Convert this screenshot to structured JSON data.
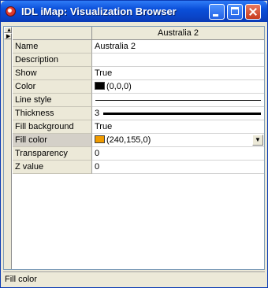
{
  "window": {
    "title": "IDL iMap: Visualization Browser",
    "title_bar_color": "#0a4fd9"
  },
  "grid": {
    "column_header": "Australia 2",
    "rows": [
      {
        "label": "Name",
        "value": "Australia 2"
      },
      {
        "label": "Description",
        "value": ""
      },
      {
        "label": "Show",
        "value": "True"
      },
      {
        "label": "Color",
        "value": "(0,0,0)",
        "swatch": "#000000"
      },
      {
        "label": "Line style",
        "value": ""
      },
      {
        "label": "Thickness",
        "value": "3"
      },
      {
        "label": "Fill background",
        "value": "True"
      },
      {
        "label": "Fill color",
        "value": "(240,155,0)",
        "swatch": "#f09b00"
      },
      {
        "label": "Transparency",
        "value": "0"
      },
      {
        "label": "Z value",
        "value": "0"
      }
    ]
  },
  "status": {
    "text": "Fill color"
  },
  "icons": {
    "app": "idl-app-icon",
    "minimize": "minimize-icon",
    "maximize": "maximize-icon",
    "close": "close-icon",
    "dropdown": "chevron-down-icon"
  }
}
